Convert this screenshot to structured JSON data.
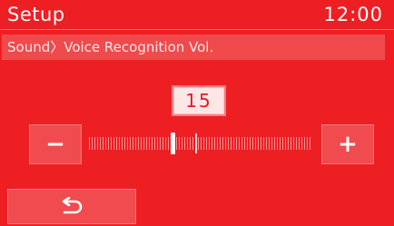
{
  "header": {
    "title": "Setup",
    "clock": "12:00"
  },
  "breadcrumb": {
    "text": "Sound〉Voice Recognition Vol."
  },
  "volume": {
    "value": "15",
    "level": 15,
    "min": 0,
    "max": 40,
    "default_marker": 19
  },
  "controls": {
    "minus_label": "−",
    "plus_label": "+"
  },
  "icons": {
    "back": "return-arrow-icon"
  },
  "colors": {
    "background": "#ee1f23",
    "panel": "#f04b4e",
    "value_box": "#fde6e6",
    "text": "#ffffff"
  }
}
